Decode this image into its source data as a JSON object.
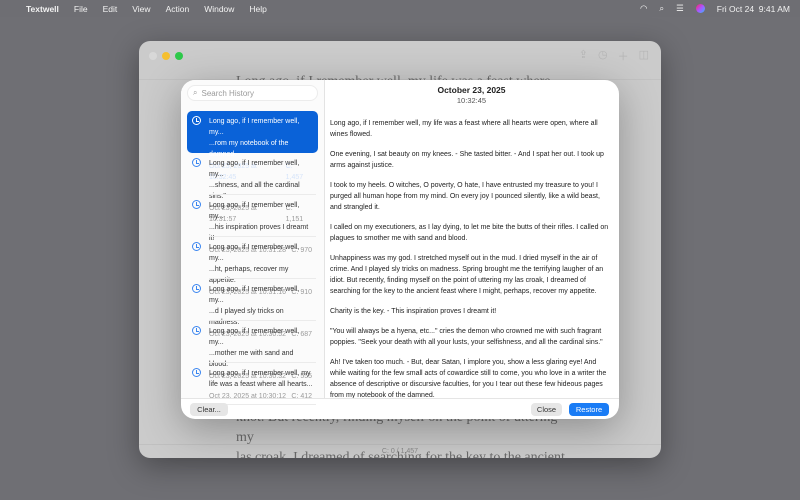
{
  "menubar": {
    "app": "Textwell",
    "items": [
      "File",
      "Edit",
      "View",
      "Action",
      "Window",
      "Help"
    ],
    "datetime": "Fri Oct 24  9:41 AM"
  },
  "editor": {
    "top_line": "Long ago, if I remember well, my life was a feast where all",
    "bottom_lines": [
      "knot. But recently, finding myself on the point of uttering my",
      "las croak, I dreamed of searching for the key to the ancient"
    ],
    "status": "C: 0 / 1,457"
  },
  "history": {
    "search_placeholder": "Search History",
    "items": [
      {
        "line1": "Long ago, if I remember well, my...",
        "line2": "...rom my notebook of the damned.",
        "date": "Oct 23, 2025 at 10:32:45",
        "count": "C: 1,457"
      },
      {
        "line1": "Long ago, if I remember well, my...",
        "line2": "...shness, and all the cardinal sins.\"",
        "date": "Oct 23, 2025 at 10:31:57",
        "count": "C: 1,151"
      },
      {
        "line1": "Long ago, if I remember well, my...",
        "line2": "...his inspiration proves I dreamt it!",
        "date": "Oct 23, 2025 at 10:31:28",
        "count": "C: 970"
      },
      {
        "line1": "Long ago, if I remember well, my...",
        "line2": "...ht, perhaps, recover my appetite.",
        "date": "Oct 23, 2025 at 10:31:16",
        "count": "C: 910"
      },
      {
        "line1": "Long ago, if I remember well, my...",
        "line2": "...d I played sly tricks on madness.",
        "date": "Oct 23, 2025 at 10:30:52",
        "count": "C: 687"
      },
      {
        "line1": "Long ago, if I remember well, my...",
        "line2": "...mother me with sand and blood.",
        "date": "Oct 23, 2025 at 10:30:32",
        "count": "C: 555"
      },
      {
        "line1": "Long ago, if I remember well, my",
        "line2": "life was a feast where all hearts...",
        "date": "Oct 23, 2025 at 10:30:12",
        "count": "C: 412"
      }
    ],
    "detail": {
      "date": "October 23, 2025",
      "time": "10:32:45",
      "paragraphs": [
        "Long ago, if I remember well, my life was a feast where all hearts were open, where all wines flowed.",
        "One evening, I sat beauty on my knees. - She tasted bitter. - And I spat her out. I took up arms against justice.",
        "I took to my heels. O witches, O poverty, O hate, I have entrusted my treasure to you! I purged all human hope from my mind. On every joy I pounced silently, like a wild beast, and strangled it.",
        "I called on my executioners, as I lay dying, to let me bite the butts of their rifles. I called on plagues to smother me with sand and blood.",
        "Unhappiness was my god. I stretched myself out in the mud. I dried myself in the air of crime. And I played sly tricks on madness. Spring brought me the terrifying laugher of an idiot. But recently, finding myself on the point of uttering my las croak, I dreamed of searching for the key to the ancient feast where I might, perhaps, recover my appetite.",
        "Charity is the key. - This inspiration proves I dreamt it!",
        "\"You will always be a hyena, etc...\" cries the demon who crowned me with such fragrant poppies. \"Seek your death with all your lusts, your selfishness, and all the cardinal sins.\"",
        "Ah! I've taken too much. - But, dear Satan, I implore you, show a less glaring eye! And while waiting for the few small acts of cowardice still to come, you who love in a writer the absence of descriptive or discursive faculties, for you I tear out these few hideous pages from my notebook of the damned."
      ]
    },
    "buttons": {
      "clear": "Clear...",
      "close": "Close",
      "restore": "Restore"
    }
  },
  "colors": {
    "accent": "#1a7cf5",
    "selected": "#0a62d8"
  }
}
